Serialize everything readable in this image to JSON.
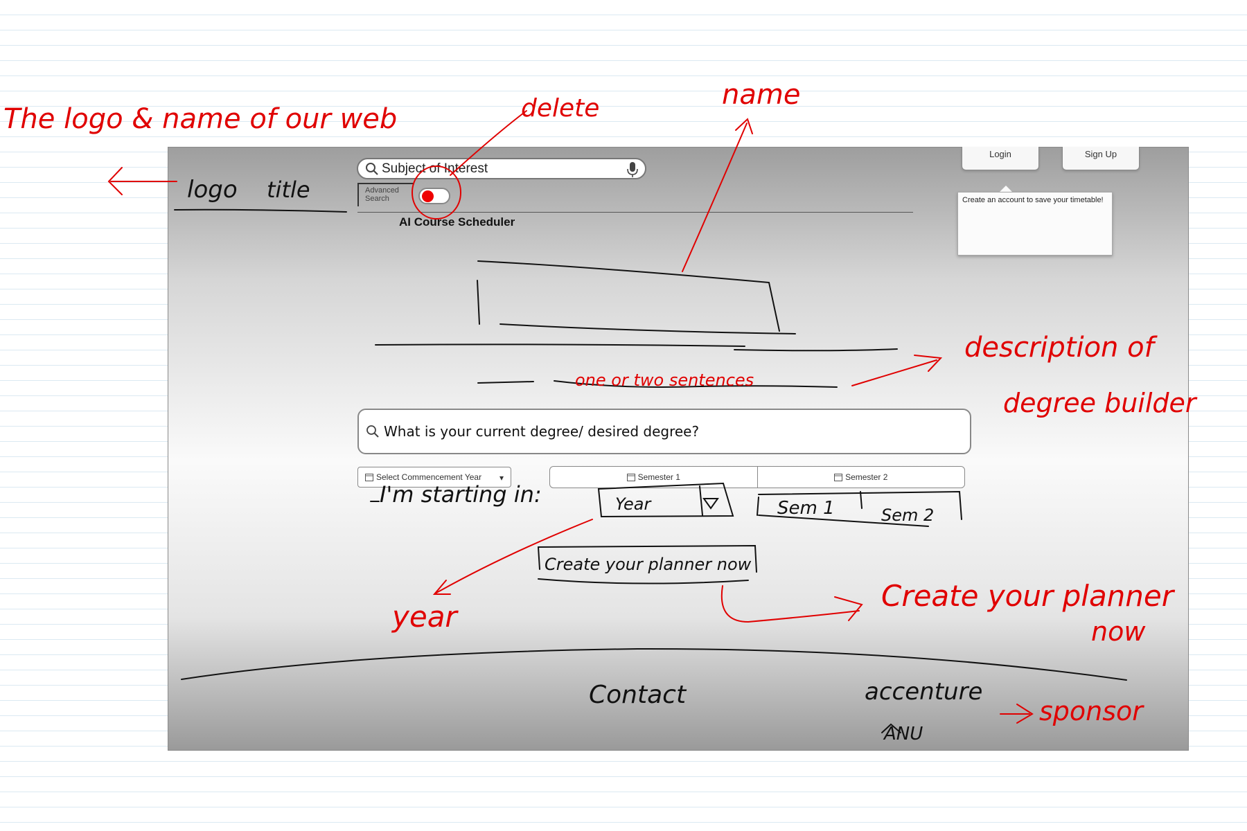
{
  "mockup": {
    "logo_text": "logo",
    "site_title_text": "title",
    "search_placeholder": "Subject of Interest",
    "advanced_search_line1": "Advanced",
    "advanced_search_line2": "Search",
    "app_title": "AI Course Scheduler",
    "login_label": "Login",
    "signup_label": "Sign Up",
    "callout_text": "Create an account to save your timetable!",
    "degree_search_placeholder": "What is your current degree/ desired degree?",
    "select_year_label": "Select Commencement Year",
    "semester1_label": "Semester 1",
    "semester2_label": "Semester 2"
  },
  "sketch": {
    "starting_in": "I'm starting in:",
    "year_dropdown": "Year",
    "sem1": "Sem 1",
    "sem2": "Sem 2",
    "create_button": "Create your planner now",
    "one_or_two": "one or two sentences",
    "contact": "Contact",
    "sponsor_text": "accenture",
    "sponsor_text2": "ANU"
  },
  "annotations": {
    "logo_note": "The logo & name of our web",
    "delete_note": "delete",
    "name_note": "name",
    "description_note_line1": "description of",
    "description_note_line2": "degree builder",
    "year_note": "year",
    "create_note_line1": "Create your planner",
    "create_note_line2": "now",
    "sponsor_note": "sponsor"
  },
  "colors": {
    "annotation": "#e00000",
    "sketch": "#111111",
    "toggle_knob": "#ee0000"
  }
}
